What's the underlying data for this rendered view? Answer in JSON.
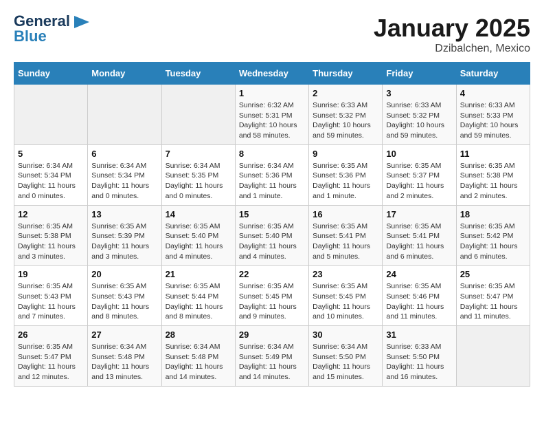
{
  "header": {
    "logo_general": "General",
    "logo_blue": "Blue",
    "month_title": "January 2025",
    "location": "Dzibalchen, Mexico"
  },
  "weekdays": [
    "Sunday",
    "Monday",
    "Tuesday",
    "Wednesday",
    "Thursday",
    "Friday",
    "Saturday"
  ],
  "weeks": [
    [
      {
        "day": "",
        "info": ""
      },
      {
        "day": "",
        "info": ""
      },
      {
        "day": "",
        "info": ""
      },
      {
        "day": "1",
        "info": "Sunrise: 6:32 AM\nSunset: 5:31 PM\nDaylight: 10 hours\nand 58 minutes."
      },
      {
        "day": "2",
        "info": "Sunrise: 6:33 AM\nSunset: 5:32 PM\nDaylight: 10 hours\nand 59 minutes."
      },
      {
        "day": "3",
        "info": "Sunrise: 6:33 AM\nSunset: 5:32 PM\nDaylight: 10 hours\nand 59 minutes."
      },
      {
        "day": "4",
        "info": "Sunrise: 6:33 AM\nSunset: 5:33 PM\nDaylight: 10 hours\nand 59 minutes."
      }
    ],
    [
      {
        "day": "5",
        "info": "Sunrise: 6:34 AM\nSunset: 5:34 PM\nDaylight: 11 hours\nand 0 minutes."
      },
      {
        "day": "6",
        "info": "Sunrise: 6:34 AM\nSunset: 5:34 PM\nDaylight: 11 hours\nand 0 minutes."
      },
      {
        "day": "7",
        "info": "Sunrise: 6:34 AM\nSunset: 5:35 PM\nDaylight: 11 hours\nand 0 minutes."
      },
      {
        "day": "8",
        "info": "Sunrise: 6:34 AM\nSunset: 5:36 PM\nDaylight: 11 hours\nand 1 minute."
      },
      {
        "day": "9",
        "info": "Sunrise: 6:35 AM\nSunset: 5:36 PM\nDaylight: 11 hours\nand 1 minute."
      },
      {
        "day": "10",
        "info": "Sunrise: 6:35 AM\nSunset: 5:37 PM\nDaylight: 11 hours\nand 2 minutes."
      },
      {
        "day": "11",
        "info": "Sunrise: 6:35 AM\nSunset: 5:38 PM\nDaylight: 11 hours\nand 2 minutes."
      }
    ],
    [
      {
        "day": "12",
        "info": "Sunrise: 6:35 AM\nSunset: 5:38 PM\nDaylight: 11 hours\nand 3 minutes."
      },
      {
        "day": "13",
        "info": "Sunrise: 6:35 AM\nSunset: 5:39 PM\nDaylight: 11 hours\nand 3 minutes."
      },
      {
        "day": "14",
        "info": "Sunrise: 6:35 AM\nSunset: 5:40 PM\nDaylight: 11 hours\nand 4 minutes."
      },
      {
        "day": "15",
        "info": "Sunrise: 6:35 AM\nSunset: 5:40 PM\nDaylight: 11 hours\nand 4 minutes."
      },
      {
        "day": "16",
        "info": "Sunrise: 6:35 AM\nSunset: 5:41 PM\nDaylight: 11 hours\nand 5 minutes."
      },
      {
        "day": "17",
        "info": "Sunrise: 6:35 AM\nSunset: 5:41 PM\nDaylight: 11 hours\nand 6 minutes."
      },
      {
        "day": "18",
        "info": "Sunrise: 6:35 AM\nSunset: 5:42 PM\nDaylight: 11 hours\nand 6 minutes."
      }
    ],
    [
      {
        "day": "19",
        "info": "Sunrise: 6:35 AM\nSunset: 5:43 PM\nDaylight: 11 hours\nand 7 minutes."
      },
      {
        "day": "20",
        "info": "Sunrise: 6:35 AM\nSunset: 5:43 PM\nDaylight: 11 hours\nand 8 minutes."
      },
      {
        "day": "21",
        "info": "Sunrise: 6:35 AM\nSunset: 5:44 PM\nDaylight: 11 hours\nand 8 minutes."
      },
      {
        "day": "22",
        "info": "Sunrise: 6:35 AM\nSunset: 5:45 PM\nDaylight: 11 hours\nand 9 minutes."
      },
      {
        "day": "23",
        "info": "Sunrise: 6:35 AM\nSunset: 5:45 PM\nDaylight: 11 hours\nand 10 minutes."
      },
      {
        "day": "24",
        "info": "Sunrise: 6:35 AM\nSunset: 5:46 PM\nDaylight: 11 hours\nand 11 minutes."
      },
      {
        "day": "25",
        "info": "Sunrise: 6:35 AM\nSunset: 5:47 PM\nDaylight: 11 hours\nand 11 minutes."
      }
    ],
    [
      {
        "day": "26",
        "info": "Sunrise: 6:35 AM\nSunset: 5:47 PM\nDaylight: 11 hours\nand 12 minutes."
      },
      {
        "day": "27",
        "info": "Sunrise: 6:34 AM\nSunset: 5:48 PM\nDaylight: 11 hours\nand 13 minutes."
      },
      {
        "day": "28",
        "info": "Sunrise: 6:34 AM\nSunset: 5:48 PM\nDaylight: 11 hours\nand 14 minutes."
      },
      {
        "day": "29",
        "info": "Sunrise: 6:34 AM\nSunset: 5:49 PM\nDaylight: 11 hours\nand 14 minutes."
      },
      {
        "day": "30",
        "info": "Sunrise: 6:34 AM\nSunset: 5:50 PM\nDaylight: 11 hours\nand 15 minutes."
      },
      {
        "day": "31",
        "info": "Sunrise: 6:33 AM\nSunset: 5:50 PM\nDaylight: 11 hours\nand 16 minutes."
      },
      {
        "day": "",
        "info": ""
      }
    ]
  ]
}
